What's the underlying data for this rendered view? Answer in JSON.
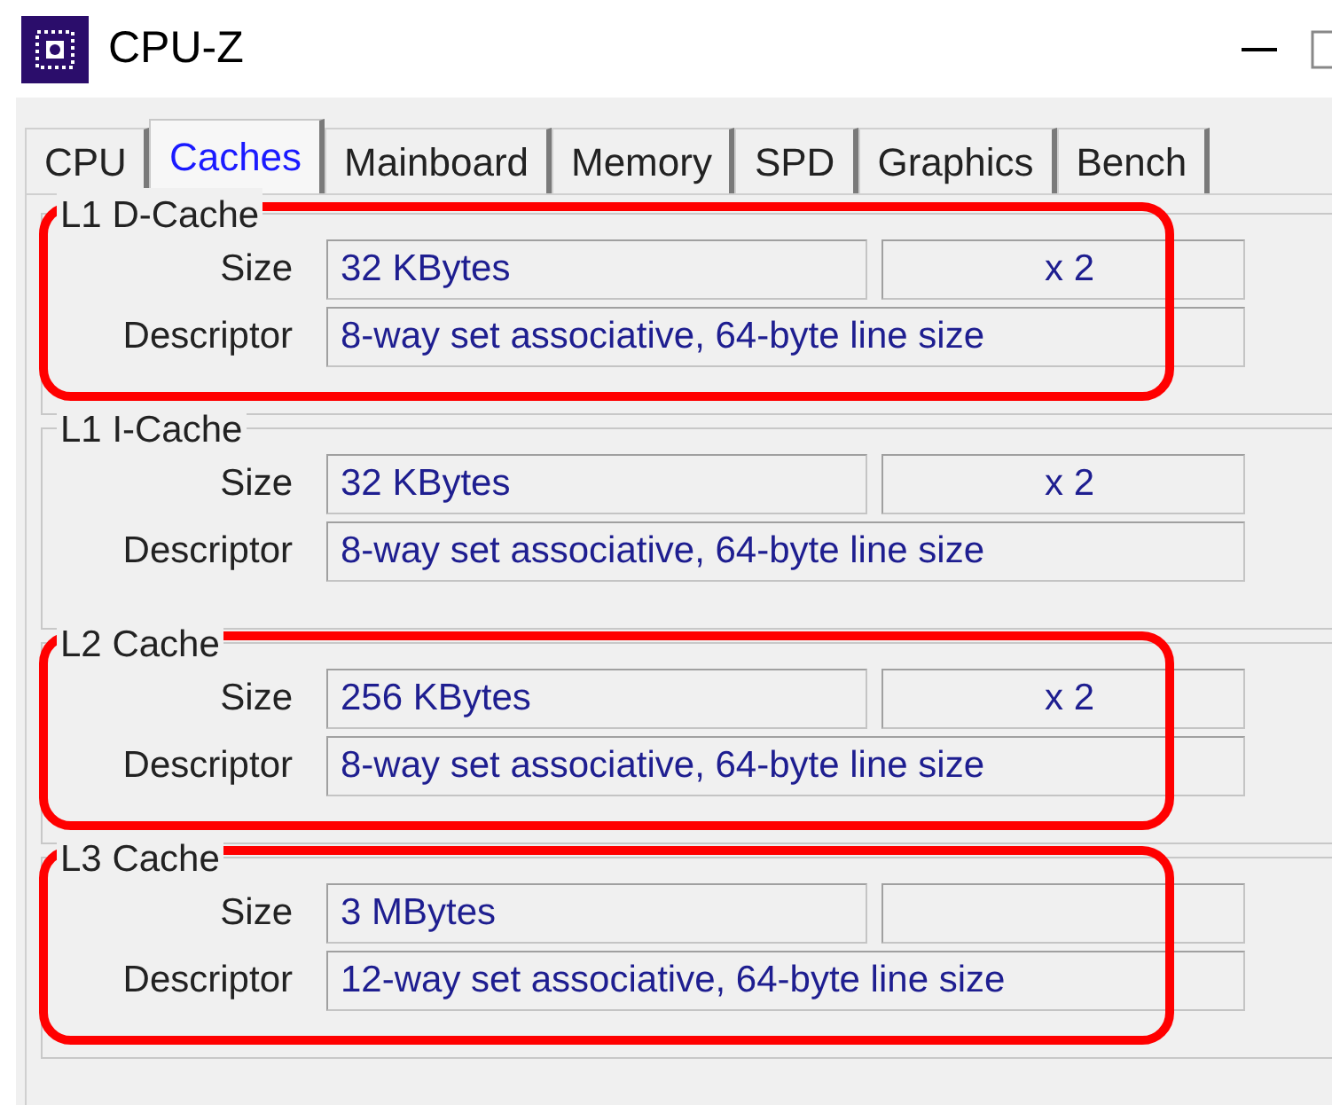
{
  "window": {
    "title": "CPU-Z"
  },
  "tabs": [
    {
      "label": "CPU",
      "selected": false
    },
    {
      "label": "Caches",
      "selected": true
    },
    {
      "label": "Mainboard",
      "selected": false
    },
    {
      "label": "Memory",
      "selected": false
    },
    {
      "label": "SPD",
      "selected": false
    },
    {
      "label": "Graphics",
      "selected": false
    },
    {
      "label": "Bench",
      "selected": false
    }
  ],
  "groups": [
    {
      "title": "L1 D-Cache",
      "highlighted": true,
      "size_label": "Size",
      "size": "32 KBytes",
      "count": "x 2",
      "descriptor_label": "Descriptor",
      "descriptor": "8-way set associative, 64-byte line size"
    },
    {
      "title": "L1 I-Cache",
      "highlighted": false,
      "size_label": "Size",
      "size": "32 KBytes",
      "count": "x 2",
      "descriptor_label": "Descriptor",
      "descriptor": "8-way set associative, 64-byte line size"
    },
    {
      "title": "L2 Cache",
      "highlighted": true,
      "size_label": "Size",
      "size": "256 KBytes",
      "count": "x 2",
      "descriptor_label": "Descriptor",
      "descriptor": "8-way set associative, 64-byte line size"
    },
    {
      "title": "L3 Cache",
      "highlighted": true,
      "size_label": "Size",
      "size": "3 MBytes",
      "descriptor_label": "Descriptor",
      "descriptor": "12-way set associative, 64-byte line size"
    }
  ]
}
